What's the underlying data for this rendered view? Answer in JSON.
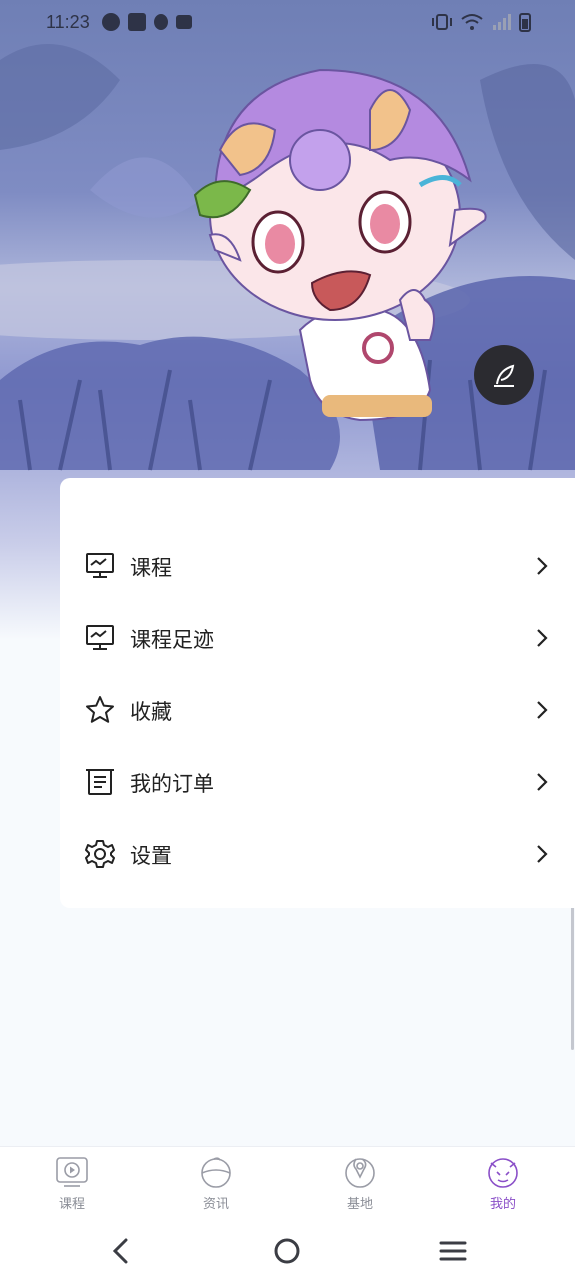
{
  "status_bar": {
    "time": "11:23",
    "left_icons": [
      "app-icon",
      "mail-icon",
      "shield-icon",
      "calendar-icon"
    ],
    "right_icons": [
      "vibrate-icon",
      "wifi-icon",
      "signal-icon",
      "battery-icon"
    ]
  },
  "hero": {
    "edit_icon": "feather-pen-icon"
  },
  "menu": {
    "items": [
      {
        "label": "课程",
        "icon": "monitor-icon"
      },
      {
        "label": "课程足迹",
        "icon": "monitor-icon"
      },
      {
        "label": "收藏",
        "icon": "star-icon"
      },
      {
        "label": "我的订单",
        "icon": "order-list-icon"
      },
      {
        "label": "设置",
        "icon": "gear-icon"
      }
    ]
  },
  "tabbar": {
    "active_color": "#8a4fc8",
    "inactive_color": "#8a8d96",
    "tabs": [
      {
        "label": "课程",
        "icon": "play-screen-icon",
        "active": false
      },
      {
        "label": "资讯",
        "icon": "news-ball-icon",
        "active": false
      },
      {
        "label": "基地",
        "icon": "map-pin-icon",
        "active": false
      },
      {
        "label": "我的",
        "icon": "mascot-face-icon",
        "active": true
      }
    ]
  },
  "navbar": {
    "buttons": [
      "back-icon",
      "home-icon",
      "menu-icon"
    ]
  }
}
